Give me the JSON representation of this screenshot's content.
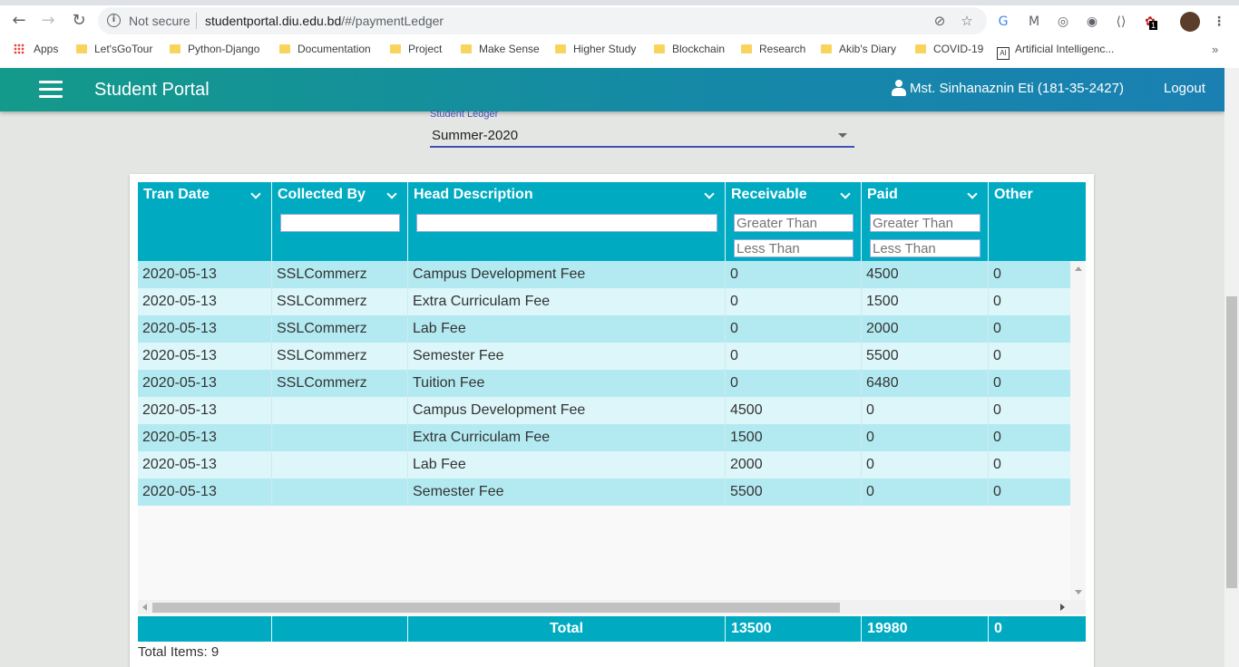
{
  "browser": {
    "security_label": "Not secure",
    "url_host": "studentportal.diu.edu.bd",
    "url_path": "/#/paymentLedger",
    "bookmarks": [
      "Apps",
      "Let'sGoTour",
      "Python-Django",
      "Documentation",
      "Project",
      "Make Sense",
      "Higher Study",
      "Blockchain",
      "Research",
      "Akib's Diary",
      "COVID-19",
      "Artificial Intelligenc..."
    ],
    "more_label": "»",
    "extension_badge": "1"
  },
  "header": {
    "title": "Student Portal",
    "user": "Mst. Sinhanaznin Eti (181-35-2427)",
    "logout_label": "Logout"
  },
  "ledger": {
    "label": "Student Ledger",
    "selected": "Summer-2020"
  },
  "grid": {
    "columns": [
      "Tran Date",
      "Collected By",
      "Head Description",
      "Receivable",
      "Paid",
      "Other"
    ],
    "filters": {
      "greater_than_placeholder": "Greater Than",
      "less_than_placeholder": "Less Than"
    },
    "rows": [
      [
        "2020-05-13",
        "SSLCommerz",
        "Campus Development Fee",
        "0",
        "4500",
        "0"
      ],
      [
        "2020-05-13",
        "SSLCommerz",
        "Extra Curriculam Fee",
        "0",
        "1500",
        "0"
      ],
      [
        "2020-05-13",
        "SSLCommerz",
        "Lab Fee",
        "0",
        "2000",
        "0"
      ],
      [
        "2020-05-13",
        "SSLCommerz",
        "Semester Fee",
        "0",
        "5500",
        "0"
      ],
      [
        "2020-05-13",
        "SSLCommerz",
        "Tuition Fee",
        "0",
        "6480",
        "0"
      ],
      [
        "2020-05-13",
        "",
        "Campus Development Fee",
        "4500",
        "0",
        "0"
      ],
      [
        "2020-05-13",
        "",
        "Extra Curriculam Fee",
        "1500",
        "0",
        "0"
      ],
      [
        "2020-05-13",
        "",
        "Lab Fee",
        "2000",
        "0",
        "0"
      ],
      [
        "2020-05-13",
        "",
        "Semester Fee",
        "5500",
        "0",
        "0"
      ]
    ],
    "footer": {
      "total_label": "Total",
      "receivable": "13500",
      "paid": "19980",
      "other": "0"
    },
    "total_items": "Total Items: 9"
  }
}
